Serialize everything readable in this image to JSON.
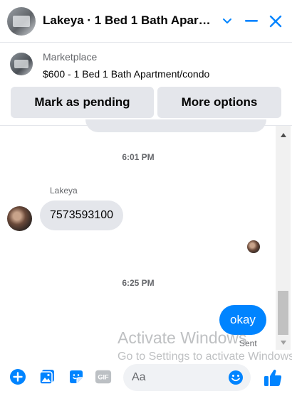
{
  "header": {
    "title": "Lakeya · 1 Bed 1 Bath Apartment/condo"
  },
  "marketplace": {
    "label": "Marketplace",
    "listing": "$600 - 1 Bed 1 Bath Apartment/condo",
    "pending_button": "Mark as pending",
    "more_button": "More options"
  },
  "conversation": {
    "timestamps": [
      "6:01 PM",
      "6:25 PM"
    ],
    "sender_name": "Lakeya",
    "incoming_message": "7573593100",
    "outgoing_message": "okay",
    "sent_status": "Sent"
  },
  "watermark": {
    "title": "Activate Windows",
    "subtitle": "Go to Settings to activate Windows."
  },
  "composer": {
    "placeholder": "Aa",
    "gif_label": "GIF"
  },
  "colors": {
    "accent": "#0084ff",
    "bubble_gray": "#e4e6eb",
    "secondary_text": "#65676b"
  },
  "icons": [
    "chevron-down-icon",
    "minimize-icon",
    "close-icon",
    "plus-circle-icon",
    "photo-icon",
    "sticker-icon",
    "gif-icon",
    "emoji-icon",
    "thumbs-up-icon",
    "scroll-up-icon",
    "scroll-down-icon"
  ]
}
